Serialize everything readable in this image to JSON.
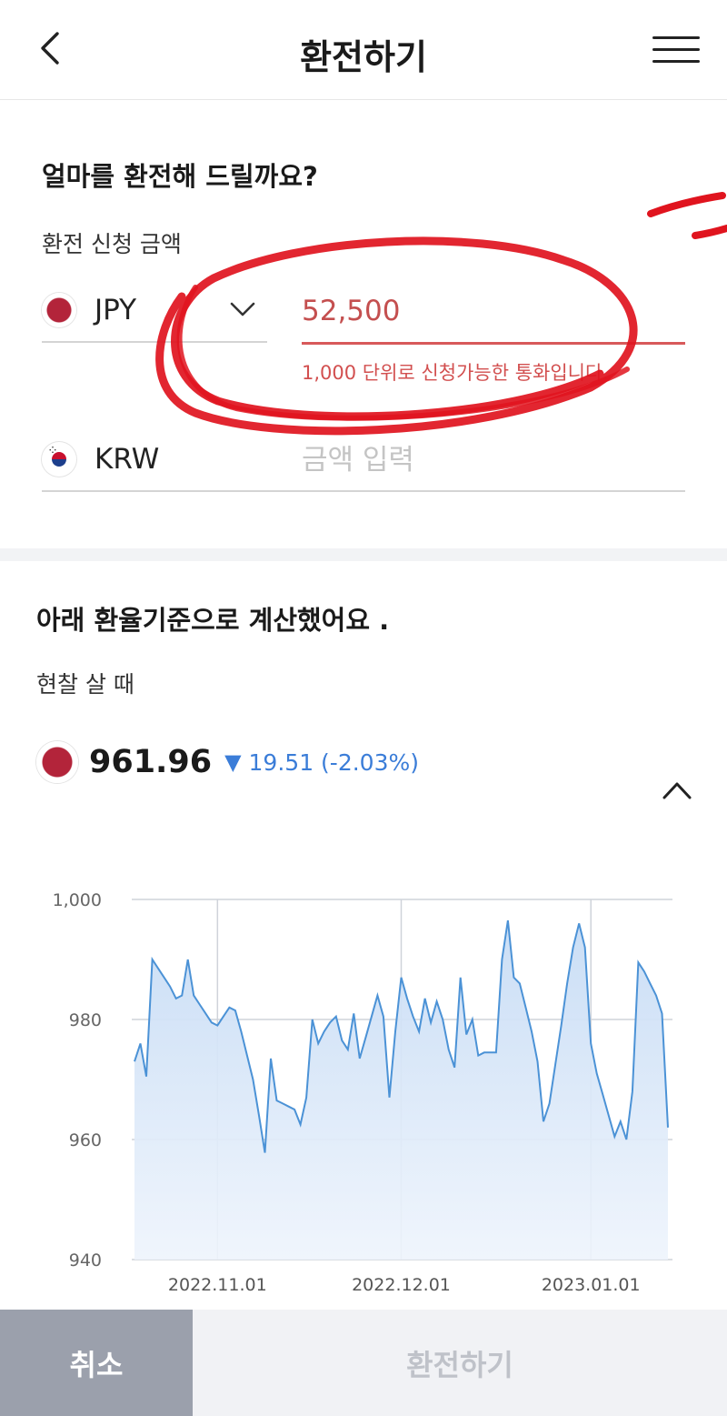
{
  "header": {
    "title": "환전하기",
    "back_icon": "chevron-left-icon",
    "menu_icon": "hamburger-menu-icon"
  },
  "exchange_form": {
    "question": "얼마를 환전해 드릴까요?",
    "amount_label": "환전 신청 금액",
    "from_currency": {
      "code": "JPY",
      "flag": "japan-flag-icon",
      "amount": "52,500"
    },
    "error_message": "1,000 단위로 신청가능한 통화입니다.",
    "to_currency": {
      "code": "KRW",
      "flag": "korea-flag-icon",
      "placeholder": "금액 입력"
    }
  },
  "rate_info": {
    "title": "아래 환율기준으로 계산했어요 .",
    "rate_type": "현찰 살 때",
    "rate": "961.96",
    "direction": "▼",
    "change": "19.51 (-2.03%)",
    "change_color": "#3b7dd8"
  },
  "chart_data": {
    "type": "area",
    "title": "",
    "xlabel": "",
    "ylabel": "",
    "ylim": [
      940,
      1000
    ],
    "y_ticks": [
      "1,000",
      "980",
      "960",
      "940"
    ],
    "x_ticks": [
      "2022.11.01",
      "2022.12.01",
      "2023.01.01"
    ],
    "grid": true,
    "line_color": "#4b92d6",
    "fill_color": "#cfe2f7",
    "series": [
      {
        "values": [
          973,
          976,
          970.5,
          990,
          988.5,
          987,
          985.5,
          983.5,
          984,
          990,
          984,
          982.5,
          981,
          979.5,
          979,
          980.5,
          982,
          981.5,
          978,
          974,
          970,
          964,
          957.8,
          973.5,
          966.5,
          966,
          965.5,
          965,
          962.5,
          967,
          980,
          976,
          978,
          979.5,
          980.5,
          976.5,
          975,
          981,
          973.5,
          977,
          980.5,
          984,
          980.5,
          967,
          978,
          987,
          983.5,
          980.5,
          978,
          983.5,
          979.5,
          983,
          980,
          975,
          972,
          987,
          977.5,
          980,
          974,
          974.5,
          974.5,
          974.5,
          990,
          996.5,
          987,
          986,
          982,
          978,
          973,
          963,
          966,
          972.5,
          979,
          986,
          992,
          996,
          992,
          976,
          971,
          967.5,
          964,
          960.5,
          963,
          960,
          968,
          989.5,
          988,
          986,
          984,
          981,
          962
        ]
      }
    ]
  },
  "buttons": {
    "cancel": "취소",
    "submit": "환전하기"
  }
}
